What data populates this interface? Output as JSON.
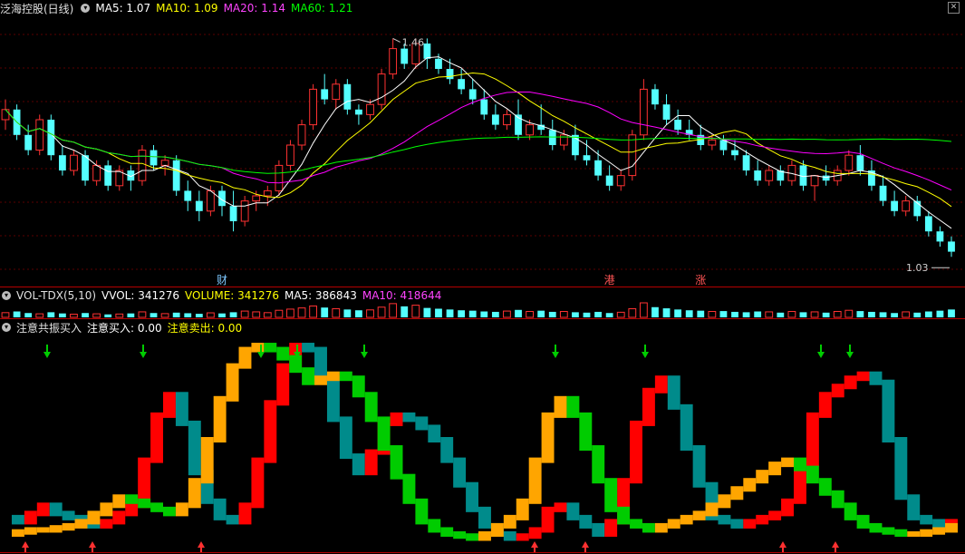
{
  "main_panel": {
    "stock_name": "泛海控股(日线)",
    "ma5_label": "MA5: 1.07",
    "ma10_label": "MA10: 1.09",
    "ma20_label": "MA20: 1.14",
    "ma60_label": "MA60: 1.21",
    "high_marker": "1.46",
    "low_marker": "1.03",
    "event_labels": [
      "财",
      "港",
      "涨"
    ]
  },
  "volume_panel": {
    "title": "VOL-TDX(5,10)",
    "vvol_label": "VVOL: 341276",
    "volume_label": "VOLUME: 341276",
    "ma5_label": "MA5: 386843",
    "ma10_label": "MA10: 418644"
  },
  "indicator_panel": {
    "title": "注意共振买入",
    "buy_label": "注意买入: 0.00",
    "sell_label": "注意卖出: 0.00"
  },
  "colors": {
    "up": "#ff3232",
    "down": "#54ffff",
    "ma5": "#ffffff",
    "ma10": "#ffff00",
    "ma20": "#ff00ff",
    "ma60": "#00ff00",
    "line1_up": "#ff0000",
    "line1_down": "#008b8b",
    "line2_up": "#ffa500",
    "line2_down": "#00cc00"
  },
  "chart_data": [
    {
      "type": "candlestick",
      "title": "泛海控股(日线)",
      "ylim": [
        1.0,
        1.5
      ],
      "ohlc": [
        [
          1.3,
          1.34,
          1.28,
          1.32
        ],
        [
          1.32,
          1.33,
          1.26,
          1.27
        ],
        [
          1.27,
          1.29,
          1.23,
          1.24
        ],
        [
          1.24,
          1.31,
          1.23,
          1.3
        ],
        [
          1.3,
          1.31,
          1.22,
          1.23
        ],
        [
          1.23,
          1.25,
          1.19,
          1.2
        ],
        [
          1.2,
          1.24,
          1.19,
          1.23
        ],
        [
          1.23,
          1.24,
          1.17,
          1.18
        ],
        [
          1.18,
          1.22,
          1.17,
          1.21
        ],
        [
          1.21,
          1.22,
          1.16,
          1.17
        ],
        [
          1.17,
          1.21,
          1.16,
          1.2
        ],
        [
          1.2,
          1.21,
          1.16,
          1.18
        ],
        [
          1.18,
          1.25,
          1.17,
          1.24
        ],
        [
          1.24,
          1.25,
          1.2,
          1.21
        ],
        [
          1.21,
          1.23,
          1.19,
          1.22
        ],
        [
          1.22,
          1.23,
          1.15,
          1.16
        ],
        [
          1.16,
          1.18,
          1.12,
          1.14
        ],
        [
          1.14,
          1.16,
          1.1,
          1.12
        ],
        [
          1.12,
          1.17,
          1.11,
          1.16
        ],
        [
          1.16,
          1.17,
          1.11,
          1.13
        ],
        [
          1.13,
          1.16,
          1.08,
          1.1
        ],
        [
          1.1,
          1.15,
          1.09,
          1.14
        ],
        [
          1.14,
          1.16,
          1.12,
          1.15
        ],
        [
          1.15,
          1.17,
          1.13,
          1.16
        ],
        [
          1.16,
          1.22,
          1.15,
          1.21
        ],
        [
          1.21,
          1.26,
          1.2,
          1.25
        ],
        [
          1.25,
          1.3,
          1.24,
          1.29
        ],
        [
          1.29,
          1.37,
          1.28,
          1.36
        ],
        [
          1.36,
          1.39,
          1.33,
          1.34
        ],
        [
          1.34,
          1.38,
          1.32,
          1.37
        ],
        [
          1.37,
          1.38,
          1.31,
          1.32
        ],
        [
          1.32,
          1.33,
          1.29,
          1.31
        ],
        [
          1.31,
          1.34,
          1.3,
          1.33
        ],
        [
          1.33,
          1.4,
          1.32,
          1.39
        ],
        [
          1.39,
          1.46,
          1.38,
          1.44
        ],
        [
          1.44,
          1.45,
          1.4,
          1.41
        ],
        [
          1.41,
          1.46,
          1.4,
          1.45
        ],
        [
          1.45,
          1.46,
          1.4,
          1.42
        ],
        [
          1.42,
          1.43,
          1.39,
          1.4
        ],
        [
          1.4,
          1.42,
          1.37,
          1.38
        ],
        [
          1.38,
          1.4,
          1.35,
          1.36
        ],
        [
          1.36,
          1.38,
          1.33,
          1.34
        ],
        [
          1.34,
          1.36,
          1.3,
          1.31
        ],
        [
          1.31,
          1.33,
          1.28,
          1.29
        ],
        [
          1.29,
          1.32,
          1.28,
          1.31
        ],
        [
          1.31,
          1.34,
          1.26,
          1.27
        ],
        [
          1.27,
          1.3,
          1.26,
          1.29
        ],
        [
          1.29,
          1.33,
          1.27,
          1.28
        ],
        [
          1.28,
          1.3,
          1.24,
          1.25
        ],
        [
          1.25,
          1.28,
          1.24,
          1.27
        ],
        [
          1.27,
          1.29,
          1.22,
          1.23
        ],
        [
          1.23,
          1.26,
          1.21,
          1.22
        ],
        [
          1.22,
          1.24,
          1.18,
          1.19
        ],
        [
          1.19,
          1.21,
          1.16,
          1.17
        ],
        [
          1.17,
          1.2,
          1.16,
          1.19
        ],
        [
          1.19,
          1.28,
          1.18,
          1.27
        ],
        [
          1.27,
          1.38,
          1.26,
          1.36
        ],
        [
          1.36,
          1.37,
          1.32,
          1.33
        ],
        [
          1.33,
          1.35,
          1.29,
          1.3
        ],
        [
          1.3,
          1.32,
          1.27,
          1.28
        ],
        [
          1.28,
          1.3,
          1.26,
          1.27
        ],
        [
          1.27,
          1.29,
          1.24,
          1.25
        ],
        [
          1.25,
          1.27,
          1.24,
          1.26
        ],
        [
          1.26,
          1.27,
          1.23,
          1.24
        ],
        [
          1.24,
          1.26,
          1.22,
          1.23
        ],
        [
          1.23,
          1.24,
          1.19,
          1.2
        ],
        [
          1.2,
          1.22,
          1.17,
          1.18
        ],
        [
          1.18,
          1.21,
          1.17,
          1.2
        ],
        [
          1.2,
          1.21,
          1.17,
          1.18
        ],
        [
          1.18,
          1.22,
          1.17,
          1.21
        ],
        [
          1.21,
          1.22,
          1.16,
          1.17
        ],
        [
          1.17,
          1.19,
          1.14,
          1.19
        ],
        [
          1.19,
          1.21,
          1.17,
          1.18
        ],
        [
          1.18,
          1.21,
          1.17,
          1.2
        ],
        [
          1.2,
          1.24,
          1.19,
          1.23
        ],
        [
          1.23,
          1.25,
          1.19,
          1.2
        ],
        [
          1.2,
          1.22,
          1.16,
          1.17
        ],
        [
          1.17,
          1.19,
          1.13,
          1.14
        ],
        [
          1.14,
          1.16,
          1.11,
          1.12
        ],
        [
          1.12,
          1.15,
          1.11,
          1.14
        ],
        [
          1.14,
          1.15,
          1.1,
          1.11
        ],
        [
          1.11,
          1.12,
          1.07,
          1.08
        ],
        [
          1.08,
          1.09,
          1.05,
          1.06
        ],
        [
          1.06,
          1.07,
          1.03,
          1.04
        ]
      ]
    },
    {
      "type": "bar",
      "title": "VOL-TDX(5,10)",
      "values": [
        24,
        30,
        22,
        18,
        26,
        20,
        16,
        22,
        18,
        15,
        17,
        20,
        28,
        22,
        19,
        24,
        21,
        18,
        23,
        20,
        26,
        32,
        28,
        24,
        36,
        42,
        48,
        58,
        50,
        44,
        40,
        36,
        38,
        52,
        70,
        56,
        62,
        48,
        44,
        40,
        36,
        34,
        30,
        28,
        32,
        38,
        30,
        34,
        28,
        30,
        26,
        24,
        28,
        22,
        26,
        44,
        74,
        52,
        46,
        40,
        36,
        34,
        30,
        32,
        28,
        26,
        30,
        28,
        24,
        30,
        26,
        28,
        24,
        30,
        36,
        32,
        28,
        26,
        22,
        28,
        24,
        30,
        34,
        40
      ]
    },
    {
      "type": "line",
      "title": "注意共振买入",
      "series": [
        {
          "values": [
            12,
            10,
            14,
            18,
            14,
            12,
            10,
            8,
            10,
            14,
            18,
            40,
            62,
            72,
            58,
            34,
            20,
            12,
            10,
            18,
            40,
            68,
            86,
            96,
            94,
            80,
            60,
            42,
            34,
            44,
            58,
            62,
            60,
            56,
            50,
            40,
            28,
            16,
            8,
            4,
            2,
            3,
            6,
            16,
            18,
            12,
            8,
            4,
            10,
            30,
            58,
            74,
            80,
            66,
            46,
            28,
            12,
            10,
            8,
            10,
            12,
            14,
            20,
            38,
            62,
            72,
            76,
            80,
            82,
            78,
            50,
            22,
            12,
            10,
            8,
            10
          ]
        },
        {
          "values": [
            4,
            5,
            6,
            6,
            7,
            8,
            10,
            14,
            18,
            22,
            20,
            18,
            16,
            14,
            18,
            30,
            50,
            70,
            86,
            94,
            96,
            94,
            90,
            84,
            78,
            80,
            82,
            80,
            72,
            60,
            46,
            32,
            20,
            10,
            6,
            4,
            3,
            2,
            4,
            8,
            12,
            20,
            40,
            62,
            70,
            62,
            46,
            30,
            16,
            10,
            8,
            6,
            8,
            10,
            12,
            14,
            18,
            22,
            26,
            30,
            34,
            38,
            40,
            36,
            30,
            24,
            18,
            12,
            8,
            6,
            5,
            4,
            4,
            5,
            6,
            8
          ]
        }
      ]
    }
  ]
}
